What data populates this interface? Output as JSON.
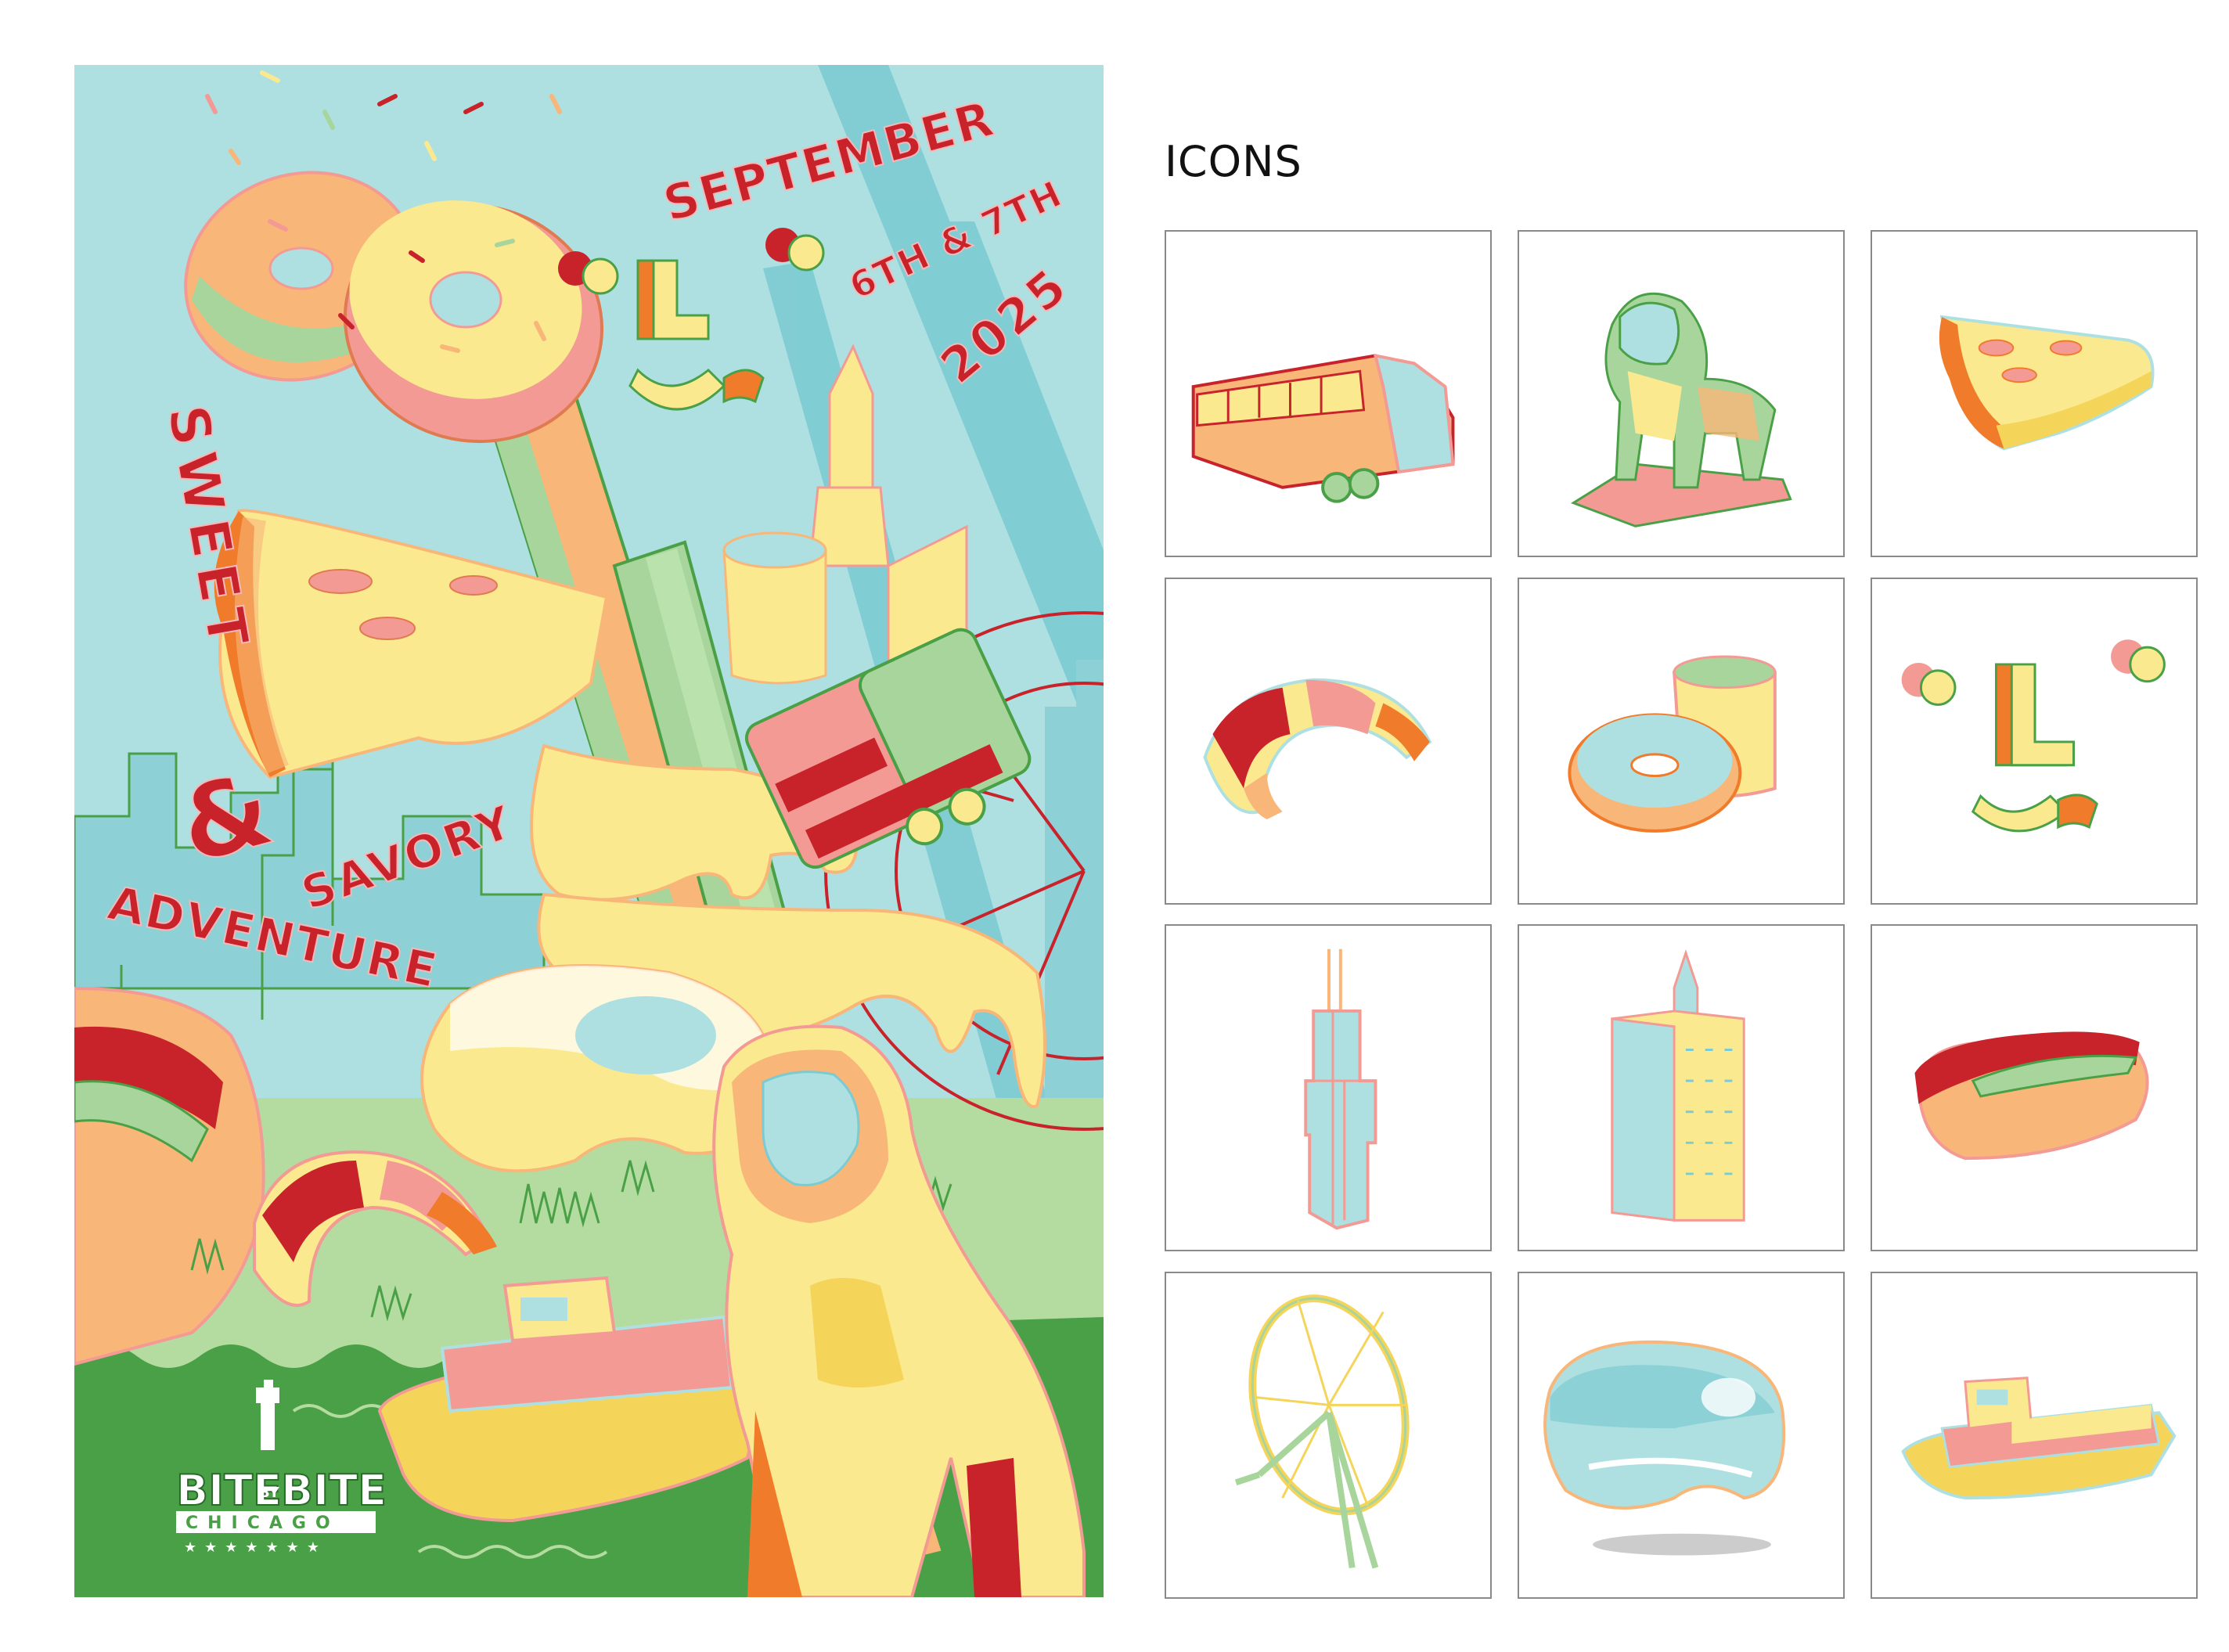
{
  "poster": {
    "title_word_1": "SWEET",
    "title_amp": "&",
    "title_word_2": "SAVORY",
    "title_word_3": "ADVENTURE",
    "date_month": "SEPTEMBER",
    "date_days": "6TH & 7TH",
    "date_year": "2025",
    "logo_left": "BITE",
    "logo_by": "BY",
    "logo_right": "BITE",
    "logo_city": "CHICAGO",
    "logo_stars": "★★★★★★★"
  },
  "icons_section": {
    "title": "ICONS",
    "items": [
      {
        "name": "train-icon"
      },
      {
        "name": "lion-statue-icon"
      },
      {
        "name": "pizza-slice-icon"
      },
      {
        "name": "croissant-icon"
      },
      {
        "name": "donut-and-coffee-icon"
      },
      {
        "name": "l-train-sign-icon"
      },
      {
        "name": "willis-tower-icon"
      },
      {
        "name": "skyscraper-icon"
      },
      {
        "name": "hot-dog-icon"
      },
      {
        "name": "ferris-wheel-icon"
      },
      {
        "name": "cloud-gate-bean-icon"
      },
      {
        "name": "boat-icon"
      }
    ]
  },
  "colors": {
    "sky": "#aee0e2",
    "teal": "#7ccbd2",
    "grass_light": "#b5dca0",
    "grass_dark": "#4aa046",
    "red": "#c8232b",
    "yellow": "#fbe98f",
    "orange": "#f8b678",
    "pink": "#f39a94",
    "green": "#a8d59c"
  }
}
